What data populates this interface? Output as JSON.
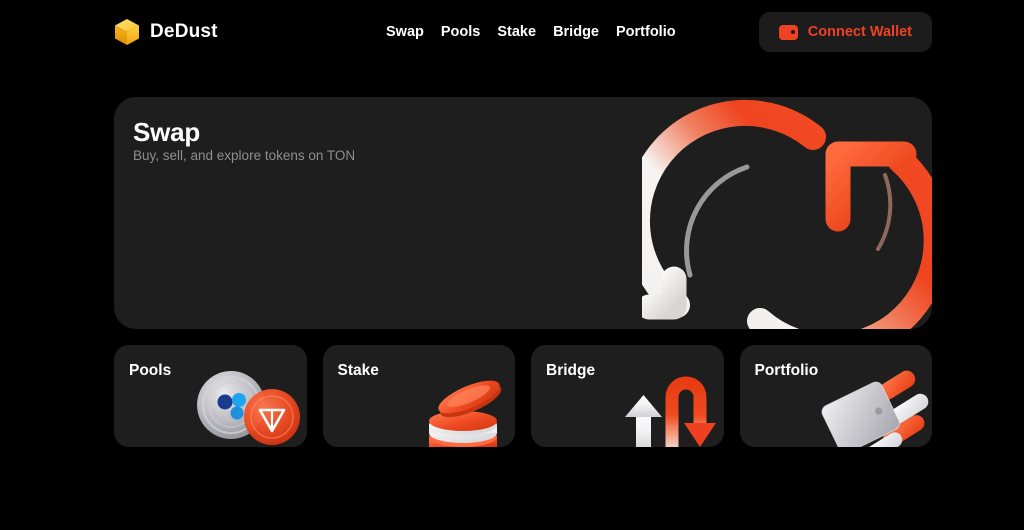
{
  "header": {
    "brand_name": "DeDust",
    "brand_icon": "gold-cube-logo",
    "nav_items": [
      {
        "label": "Swap"
      },
      {
        "label": "Pools"
      },
      {
        "label": "Stake"
      },
      {
        "label": "Bridge"
      },
      {
        "label": "Portfolio"
      }
    ],
    "wallet_button": {
      "label": "Connect Wallet",
      "icon": "wallet-icon",
      "text_color": "#ef4123",
      "background": "#1c1c1c"
    }
  },
  "hero": {
    "title": "Swap",
    "subtitle": "Buy, sell, and explore tokens on TON",
    "illustration": "circular-swap-arrows",
    "background": "#1e1e1e"
  },
  "tiles": [
    {
      "title": "Pools",
      "illustration": "coins-with-ton-logo"
    },
    {
      "title": "Stake",
      "illustration": "stacked-coin-discs"
    },
    {
      "title": "Bridge",
      "illustration": "up-arrow-and-uturn-arrow"
    },
    {
      "title": "Portfolio",
      "illustration": "silver-card-with-pills"
    }
  ],
  "theme": {
    "page_background": "#000000",
    "card_background": "#1e1e1e",
    "accent_red": "#ef4123",
    "accent_gold": "#f5b920",
    "muted_text": "#8e8e8e"
  }
}
